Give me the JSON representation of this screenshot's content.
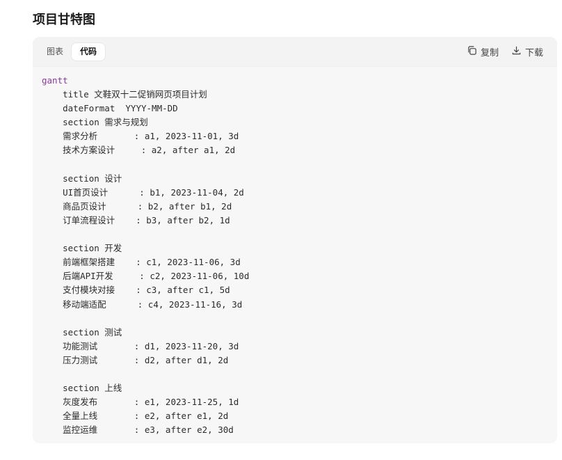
{
  "page": {
    "title": "项目甘特图"
  },
  "tabs": [
    {
      "label": "图表",
      "active": false
    },
    {
      "label": "代码",
      "active": true
    }
  ],
  "actions": {
    "copy_label": "复制",
    "download_label": "下载"
  },
  "code": {
    "lines": [
      "gantt",
      "    title 文鞋双十二促销网页项目计划",
      "    dateFormat  YYYY-MM-DD",
      "    section 需求与规划",
      "    需求分析       : a1, 2023-11-01, 3d",
      "    技术方案设计     : a2, after a1, 2d",
      "",
      "    section 设计",
      "    UI首页设计      : b1, 2023-11-04, 2d",
      "    商品页设计      : b2, after b1, 2d",
      "    订单流程设计    : b3, after b2, 1d",
      "",
      "    section 开发",
      "    前端框架搭建    : c1, 2023-11-06, 3d",
      "    后端API开发     : c2, 2023-11-06, 10d",
      "    支付模块对接    : c3, after c1, 5d",
      "    移动端适配      : c4, 2023-11-16, 3d",
      "",
      "    section 测试",
      "    功能测试       : d1, 2023-11-20, 3d",
      "    压力测试       : d2, after d1, 2d",
      "",
      "    section 上线",
      "    灰度发布       : e1, 2023-11-25, 1d",
      "    全量上线       : e2, after e1, 2d",
      "    监控运维       : e3, after e2, 30d"
    ]
  },
  "colors": {
    "keyword": "#8a3a9a",
    "text": "#2b2b2b",
    "card_bg": "#f7f7f8"
  }
}
